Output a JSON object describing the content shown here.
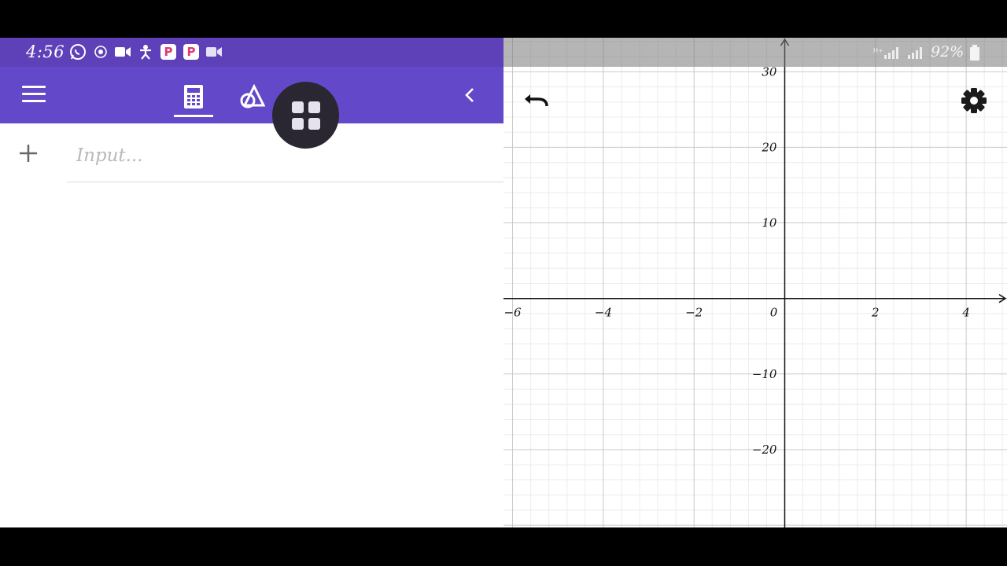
{
  "status_bar": {
    "time": "4:56",
    "battery": "92%",
    "icons": [
      "whatsapp-icon",
      "location-icon",
      "video-icon",
      "accessibility-icon",
      "p-app-icon",
      "p-app-icon",
      "video-icon"
    ],
    "pill_letter": "P"
  },
  "toolbar": {
    "tabs": [
      {
        "name": "calculator",
        "icon": "calculator-icon",
        "active": true
      },
      {
        "name": "geometry",
        "icon": "geometry-icon",
        "active": false
      },
      {
        "name": "apps",
        "icon": "apps-grid-icon",
        "active": false
      }
    ]
  },
  "algebra": {
    "input_placeholder": "Input...",
    "input_value": ""
  },
  "graph": {
    "x_ticks": [
      "−6",
      "−4",
      "−2",
      "0",
      "2",
      "4"
    ],
    "y_ticks": [
      "30",
      "20",
      "10",
      "−10",
      "−20"
    ],
    "x_tick_values": [
      -6,
      -4,
      -2,
      0,
      2,
      4
    ],
    "y_tick_values": [
      30,
      20,
      10,
      -10,
      -20
    ],
    "x_range": [
      -6.2,
      4.9
    ],
    "y_range": [
      -30.3,
      34.5
    ]
  },
  "colors": {
    "appbar": "#6349c9",
    "statusbar": "#5e40b8",
    "axis": "#111111",
    "grid_major": "#c9c9c9",
    "grid_minor": "#ececec"
  }
}
